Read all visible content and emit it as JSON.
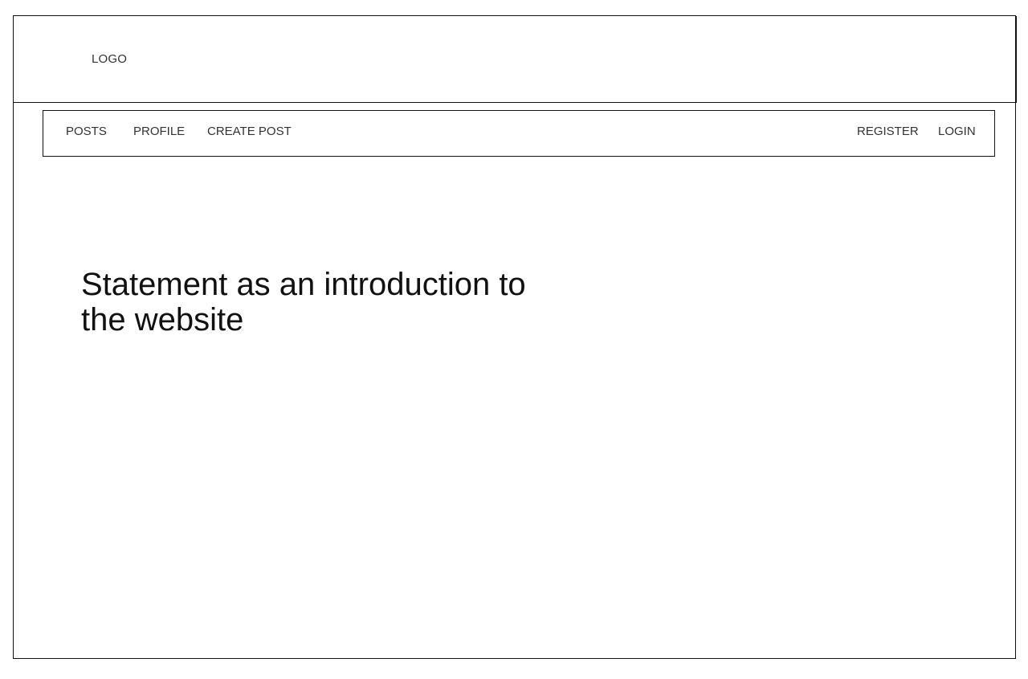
{
  "header": {
    "logo_text": "LOGO"
  },
  "nav": {
    "left": [
      {
        "label": "POSTS"
      },
      {
        "label": "PROFILE"
      },
      {
        "label": "CREATE POST"
      }
    ],
    "right": [
      {
        "label": "REGISTER"
      },
      {
        "label": "LOGIN"
      }
    ]
  },
  "hero": {
    "statement": "Statement as an introduction to the website"
  }
}
